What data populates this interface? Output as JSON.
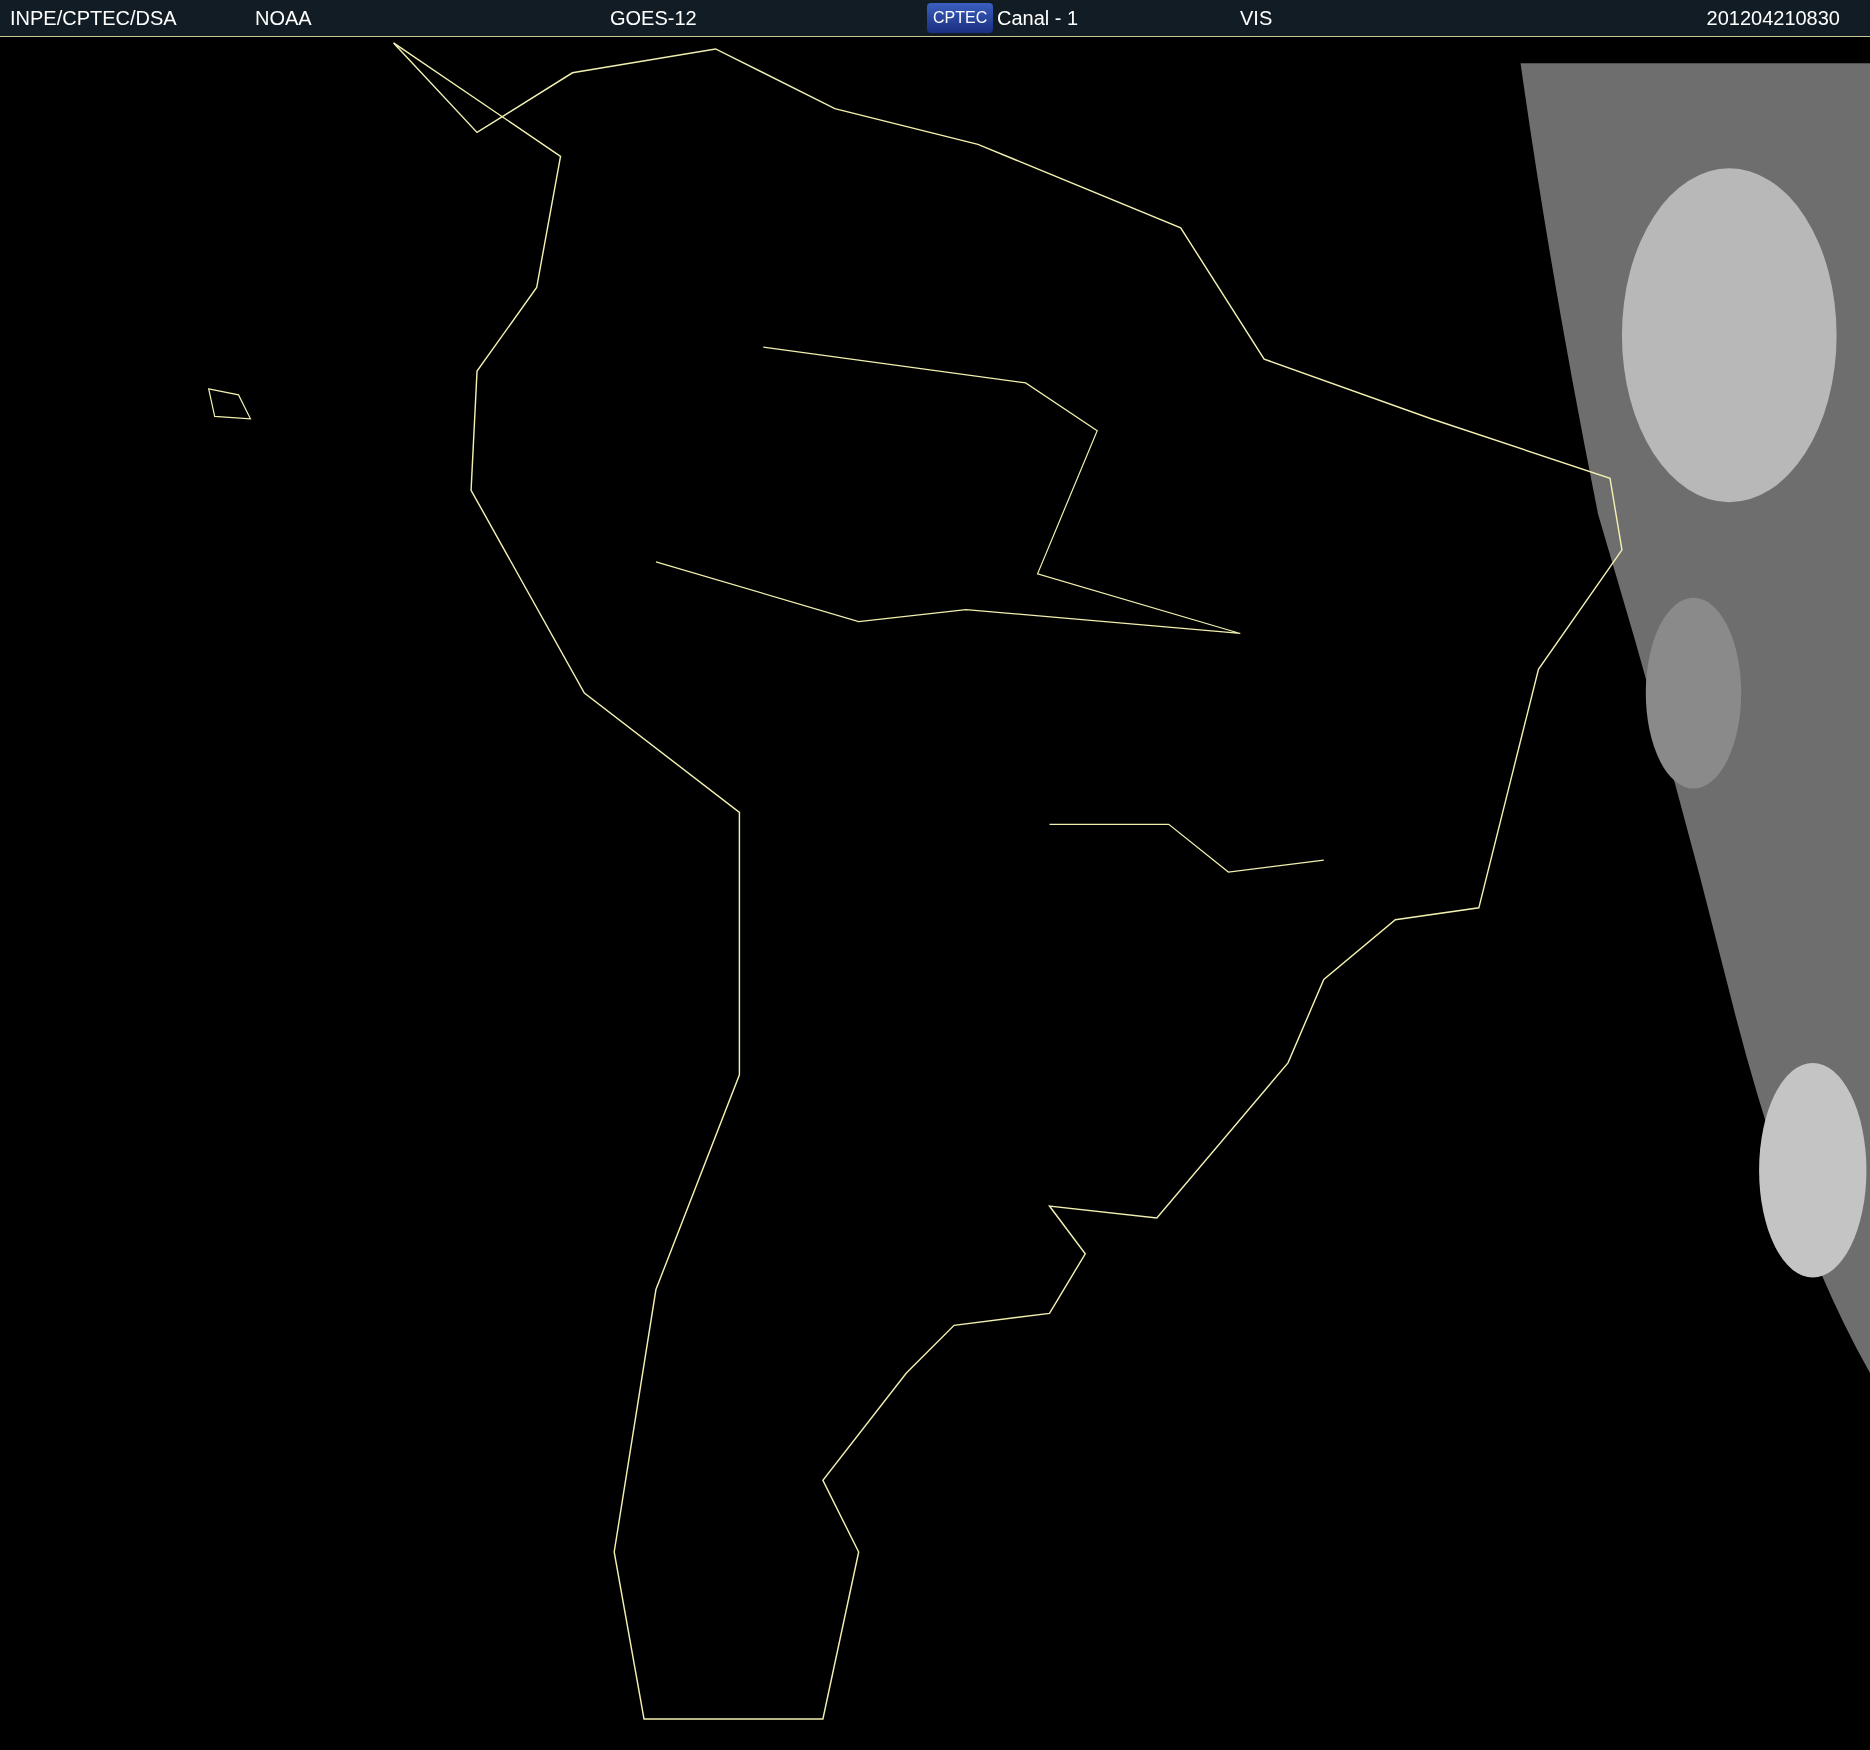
{
  "header": {
    "source": "INPE/CPTEC/DSA",
    "agency": "NOAA",
    "satellite": "GOES-12",
    "logo": "CPTEC",
    "channel": "Canal - 1",
    "band": "VIS",
    "timestamp": "201204210830"
  }
}
